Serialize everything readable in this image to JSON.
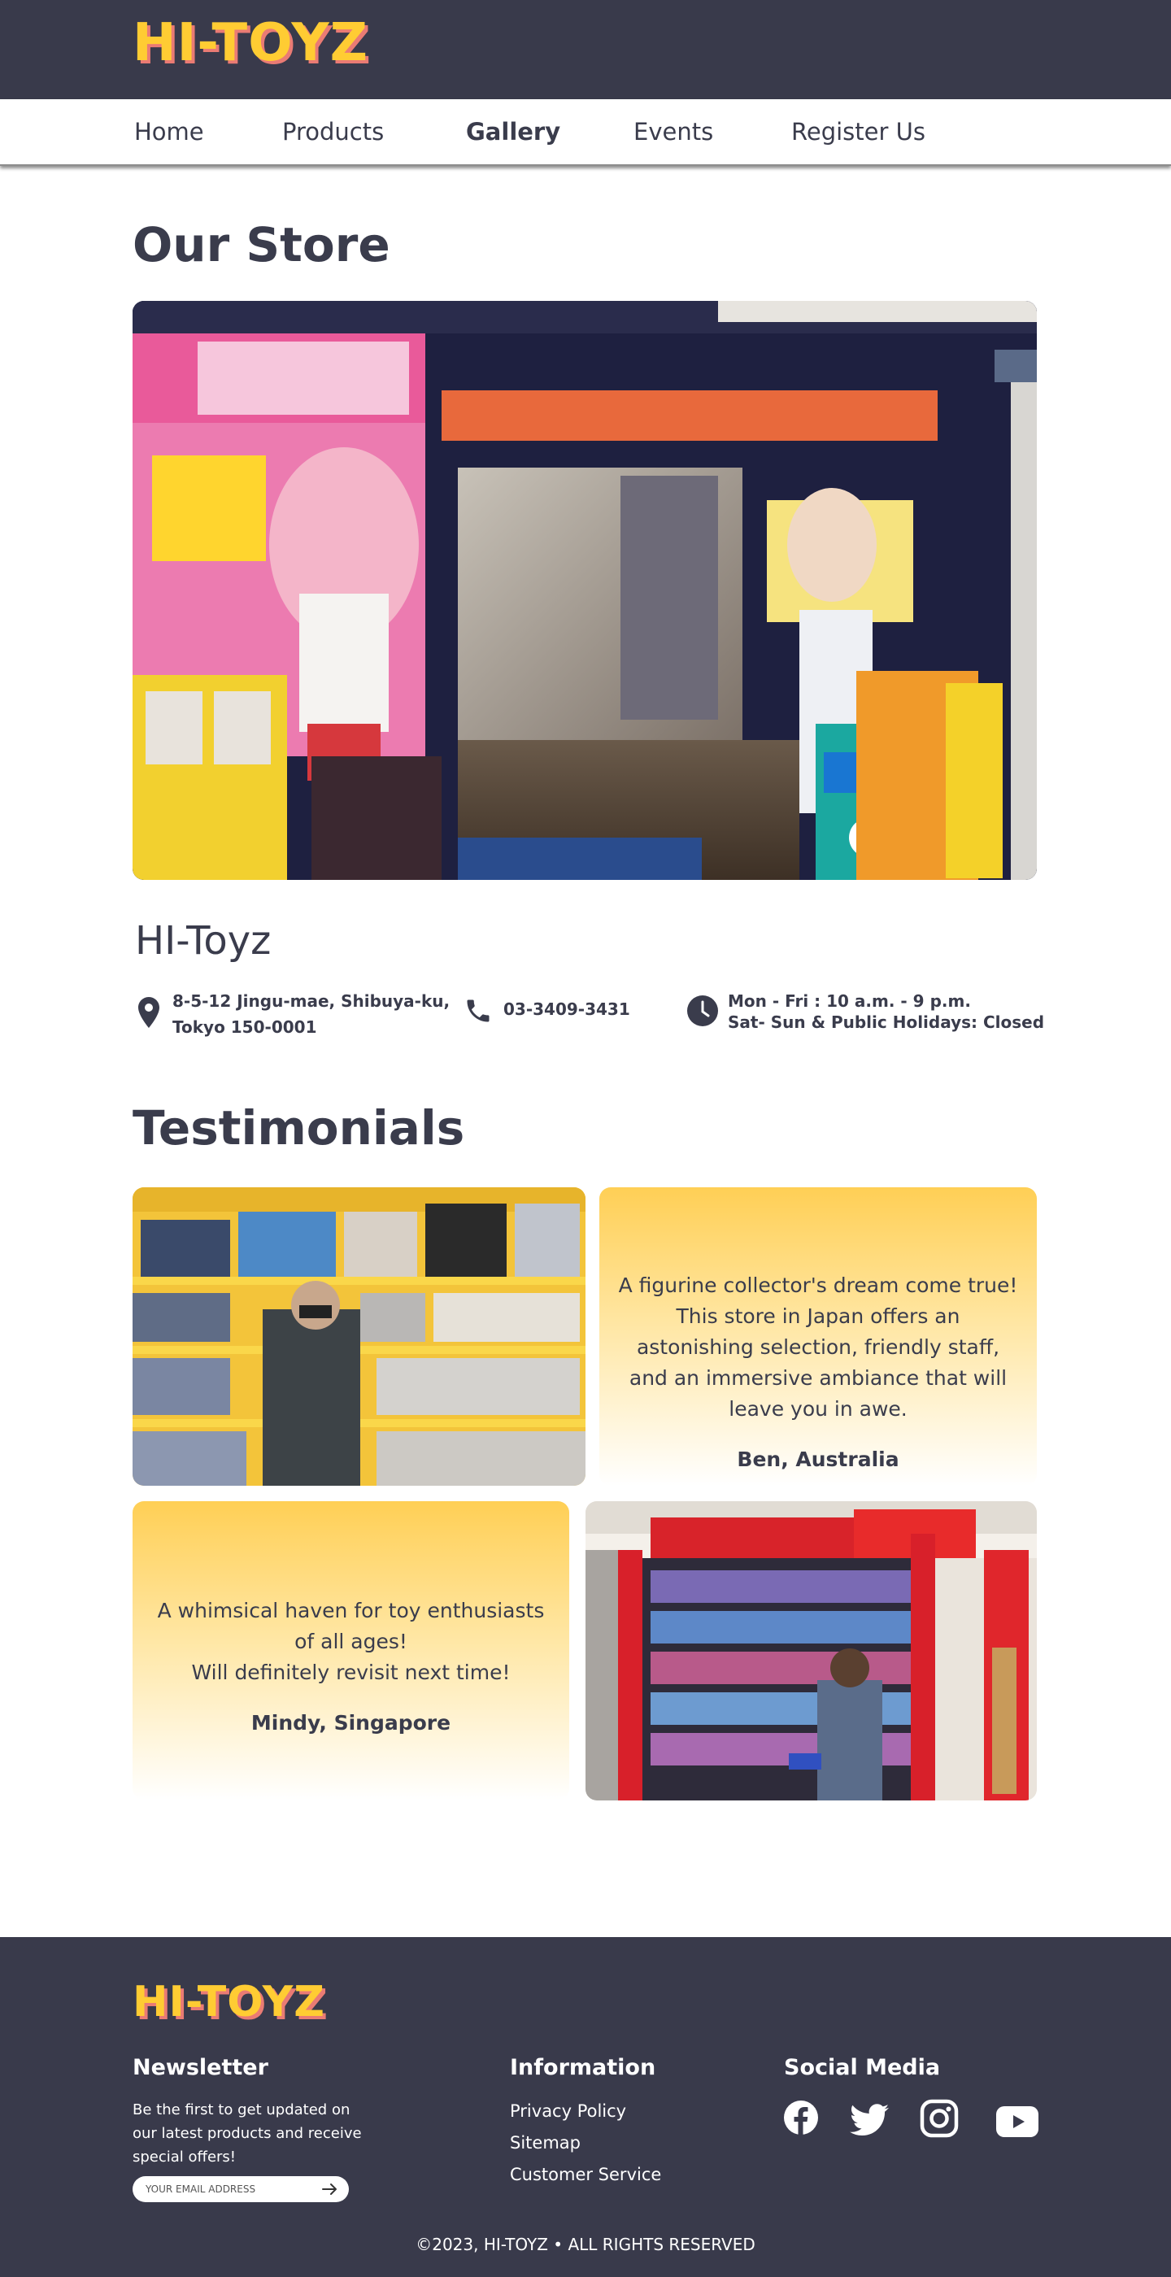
{
  "brand": {
    "logo_text": "HI-TOYZ",
    "color": "#ffcc33",
    "shadow_color": "#ea7b74"
  },
  "nav": {
    "items": [
      {
        "label": "Home",
        "active": false
      },
      {
        "label": "Products",
        "active": false
      },
      {
        "label": "Gallery",
        "active": true
      },
      {
        "label": "Events",
        "active": false
      },
      {
        "label": "Register Us",
        "active": false
      }
    ]
  },
  "store": {
    "heading": "Our Store",
    "photo_icon": "storefront-photo",
    "name": "HI-Toyz",
    "address_line1": "8-5-12 Jingu-mae, Shibuya-ku,",
    "address_line2": "Tokyo 150-0001",
    "phone": "03-3409-3431",
    "hours_line1": "Mon - Fri : 10 a.m. - 9 p.m.",
    "hours_line2": "Sat- Sun & Public Holidays: Closed"
  },
  "testimonials": {
    "heading": "Testimonials",
    "items": [
      {
        "quote": "A figurine collector's dream come true!\nThis store in Japan offers an astonishing selection, friendly staff, and an immersive ambiance that will leave you in awe.",
        "author": "Ben, Australia"
      },
      {
        "quote": "A whimsical haven for toy enthusiasts of all ages!\nWill definitely revisit next time!",
        "author": "Mindy, Singapore"
      }
    ]
  },
  "footer": {
    "newsletter": {
      "heading": "Newsletter",
      "text": "Be the first to get updated on our latest products and receive special offers!",
      "placeholder": "YOUR EMAIL ADDRESS"
    },
    "information": {
      "heading": "Information",
      "links": [
        "Privacy Policy",
        "Sitemap",
        "Customer Service"
      ]
    },
    "social": {
      "heading": "Social Media",
      "icons": [
        "facebook-icon",
        "twitter-icon",
        "instagram-icon",
        "youtube-icon"
      ]
    },
    "copyright": "©2023, HI-TOYZ • ALL RIGHTS RESERVED"
  },
  "colors": {
    "dark": "#393a4b",
    "text": "#3a3c4c",
    "card_yellow": "#ffcf55"
  }
}
